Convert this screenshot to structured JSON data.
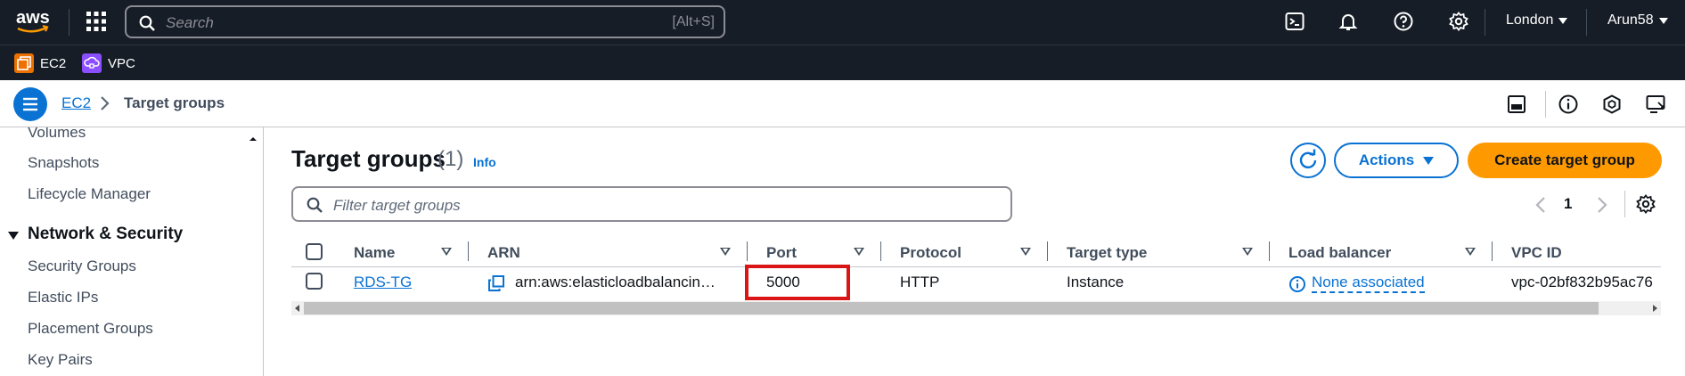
{
  "topnav": {
    "logo_text": "aws",
    "search_placeholder": "Search",
    "search_shortcut": "[Alt+S]",
    "region": "London",
    "user": "Arun58",
    "icons": [
      "cloudshell-icon",
      "bell-icon",
      "help-icon",
      "settings-icon"
    ]
  },
  "favorites": [
    {
      "label": "EC2",
      "color": "#ed7100"
    },
    {
      "label": "VPC",
      "color": "#8c4fff"
    }
  ],
  "breadcrumb": {
    "items": [
      "EC2",
      "Target groups"
    ]
  },
  "sidebar": {
    "items_top": [
      "Volumes",
      "Snapshots",
      "Lifecycle Manager"
    ],
    "section": "Network & Security",
    "section_items": [
      "Security Groups",
      "Elastic IPs",
      "Placement Groups",
      "Key Pairs"
    ]
  },
  "main": {
    "title": "Target groups",
    "count": "(1)",
    "info": "Info",
    "actions_label": "Actions",
    "create_label": "Create target group",
    "filter_placeholder": "Filter target groups",
    "page": "1"
  },
  "table": {
    "columns": [
      "Name",
      "ARN",
      "Port",
      "Protocol",
      "Target type",
      "Load balancer",
      "VPC ID"
    ],
    "rows": [
      {
        "name": "RDS-TG",
        "arn": "arn:aws:elasticloadbalancin…",
        "port": "5000",
        "protocol": "HTTP",
        "target_type": "Instance",
        "load_balancer": "None associated",
        "vpc_id": "vpc-02bf832b95ac76"
      }
    ]
  },
  "colors": {
    "nav_bg": "#161d26",
    "link": "#0972d3",
    "primary_button": "#ff9900",
    "highlight": "#d91515"
  }
}
